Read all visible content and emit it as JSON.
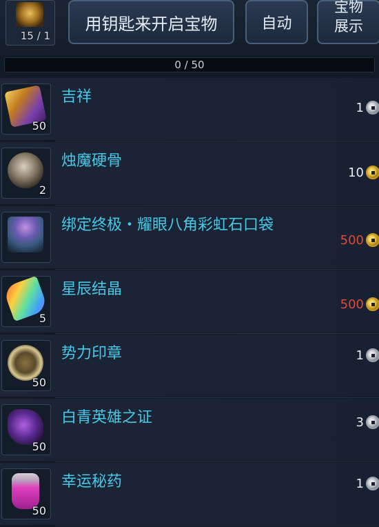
{
  "header": {
    "key_count": "15 / 1",
    "open_button": "用钥匙来开启宝物",
    "auto_button": "自动",
    "show_button": "宝物展示"
  },
  "progress": {
    "text": "0 / 50",
    "fraction": 0
  },
  "items": [
    {
      "name": "吉祥",
      "qty": "50",
      "price": "1",
      "coin": "silver",
      "price_color": "white",
      "icon": "golden-ticket-icon"
    },
    {
      "name": "烛魔硬骨",
      "qty": "2",
      "price": "10",
      "coin": "gold",
      "price_color": "white",
      "icon": "bone-egg-icon"
    },
    {
      "name": "绑定终极・耀眼八角彩虹石口袋",
      "qty": "",
      "price": "500",
      "coin": "gold",
      "price_color": "red",
      "icon": "gem-pouch-icon"
    },
    {
      "name": "星辰结晶",
      "qty": "5",
      "price": "500",
      "coin": "gold",
      "price_color": "red",
      "icon": "rainbow-crystal-icon"
    },
    {
      "name": "势力印章",
      "qty": "50",
      "price": "1",
      "coin": "silver",
      "price_color": "white",
      "icon": "faction-seal-icon"
    },
    {
      "name": "白青英雄之证",
      "qty": "50",
      "price": "3",
      "coin": "silver",
      "price_color": "white",
      "icon": "hero-proof-icon"
    },
    {
      "name": "幸运秘药",
      "qty": "50",
      "price": "1",
      "coin": "silver",
      "price_color": "white",
      "icon": "luck-potion-icon"
    }
  ]
}
